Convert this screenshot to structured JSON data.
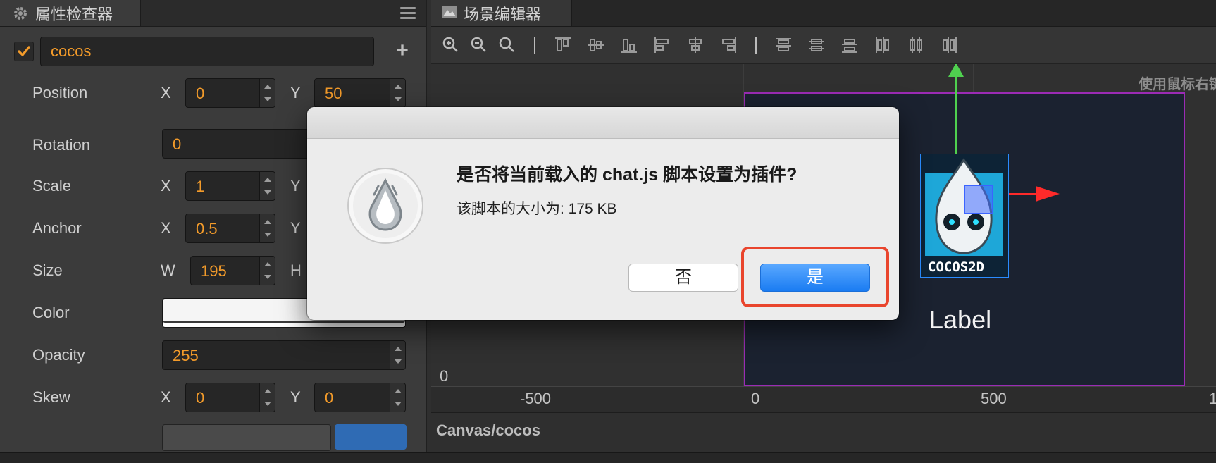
{
  "inspector": {
    "tab_title": "属性检查器",
    "node": {
      "enabled": true,
      "name": "cocos"
    },
    "props": {
      "position": {
        "label": "Position",
        "x_axis": "X",
        "x": "0",
        "y_axis": "Y",
        "y": "50"
      },
      "rotation": {
        "label": "Rotation",
        "value": "0"
      },
      "scale": {
        "label": "Scale",
        "x_axis": "X",
        "x": "1",
        "y_axis": "Y"
      },
      "anchor": {
        "label": "Anchor",
        "x_axis": "X",
        "x": "0.5",
        "y_axis": "Y"
      },
      "size": {
        "label": "Size",
        "w_axis": "W",
        "w": "195",
        "h_axis": "H"
      },
      "color": {
        "label": "Color",
        "value": "#ffffff"
      },
      "opacity": {
        "label": "Opacity",
        "value": "255"
      },
      "skew": {
        "label": "Skew",
        "x_axis": "X",
        "x": "0",
        "y_axis": "Y",
        "y": "0"
      }
    }
  },
  "scene": {
    "tab_title": "场景编辑器",
    "hint": "使用鼠标右键",
    "node_label": "Label",
    "logo_text": "COCOS2D",
    "ruler_x": [
      "-500",
      "0",
      "500",
      "1"
    ],
    "ruler_y": [
      "0"
    ],
    "breadcrumb": "Canvas/cocos"
  },
  "dialog": {
    "title": "是否将当前载入的 chat.js 脚本设置为插件?",
    "message": "该脚本的大小为: 175 KB",
    "no_label": "否",
    "yes_label": "是",
    "accent": "#1a7cf2",
    "highlight_color": "#e9452d"
  }
}
